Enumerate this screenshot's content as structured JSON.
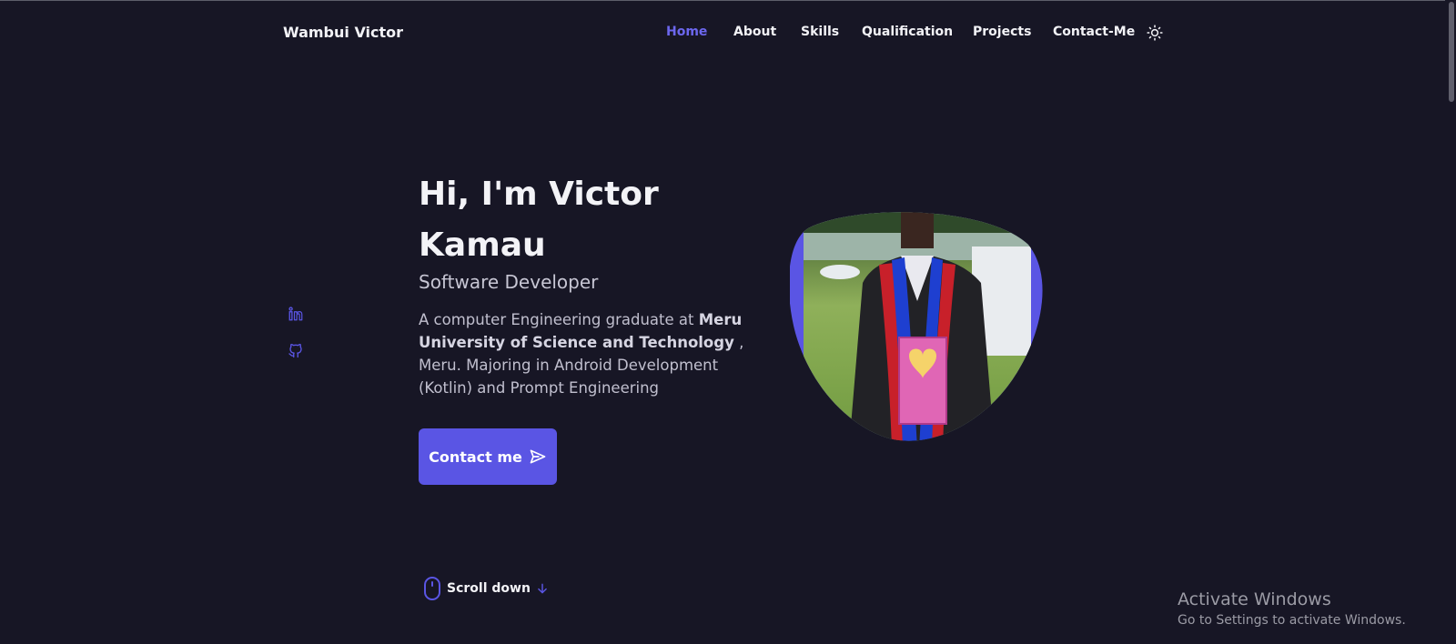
{
  "brand": "Wambui Victor",
  "nav": {
    "items": [
      {
        "label": "Home",
        "active": true
      },
      {
        "label": "About"
      },
      {
        "label": "Skills"
      },
      {
        "label": "Qualification"
      },
      {
        "label": "Projects"
      },
      {
        "label": "Contact-Me"
      }
    ],
    "theme_icon": "sun-icon"
  },
  "social": [
    {
      "icon": "linkedin-icon"
    },
    {
      "icon": "github-icon"
    }
  ],
  "hero": {
    "title": "Hi, I'm Victor Kamau",
    "subtitle": "Software Developer",
    "description_pre": "A computer Engineering graduate at ",
    "description_bold": "Meru University of Science and Technology",
    "description_post": " , Meru. Majoring in Android Development (Kotlin) and Prompt Engineering",
    "cta_label": "Contact me",
    "cta_icon": "send-icon",
    "image_alt": "graduate photo"
  },
  "scroll": {
    "label": "Scroll down",
    "icons": [
      "mouse-icon",
      "arrow-down-icon"
    ]
  },
  "windows_notice": {
    "title": "Activate Windows",
    "subtitle": "Go to Settings to activate Windows."
  },
  "colors": {
    "background": "#171625",
    "accent": "#5a55e4",
    "nav_active": "#6c67ee",
    "text": "#f3f3f7"
  }
}
